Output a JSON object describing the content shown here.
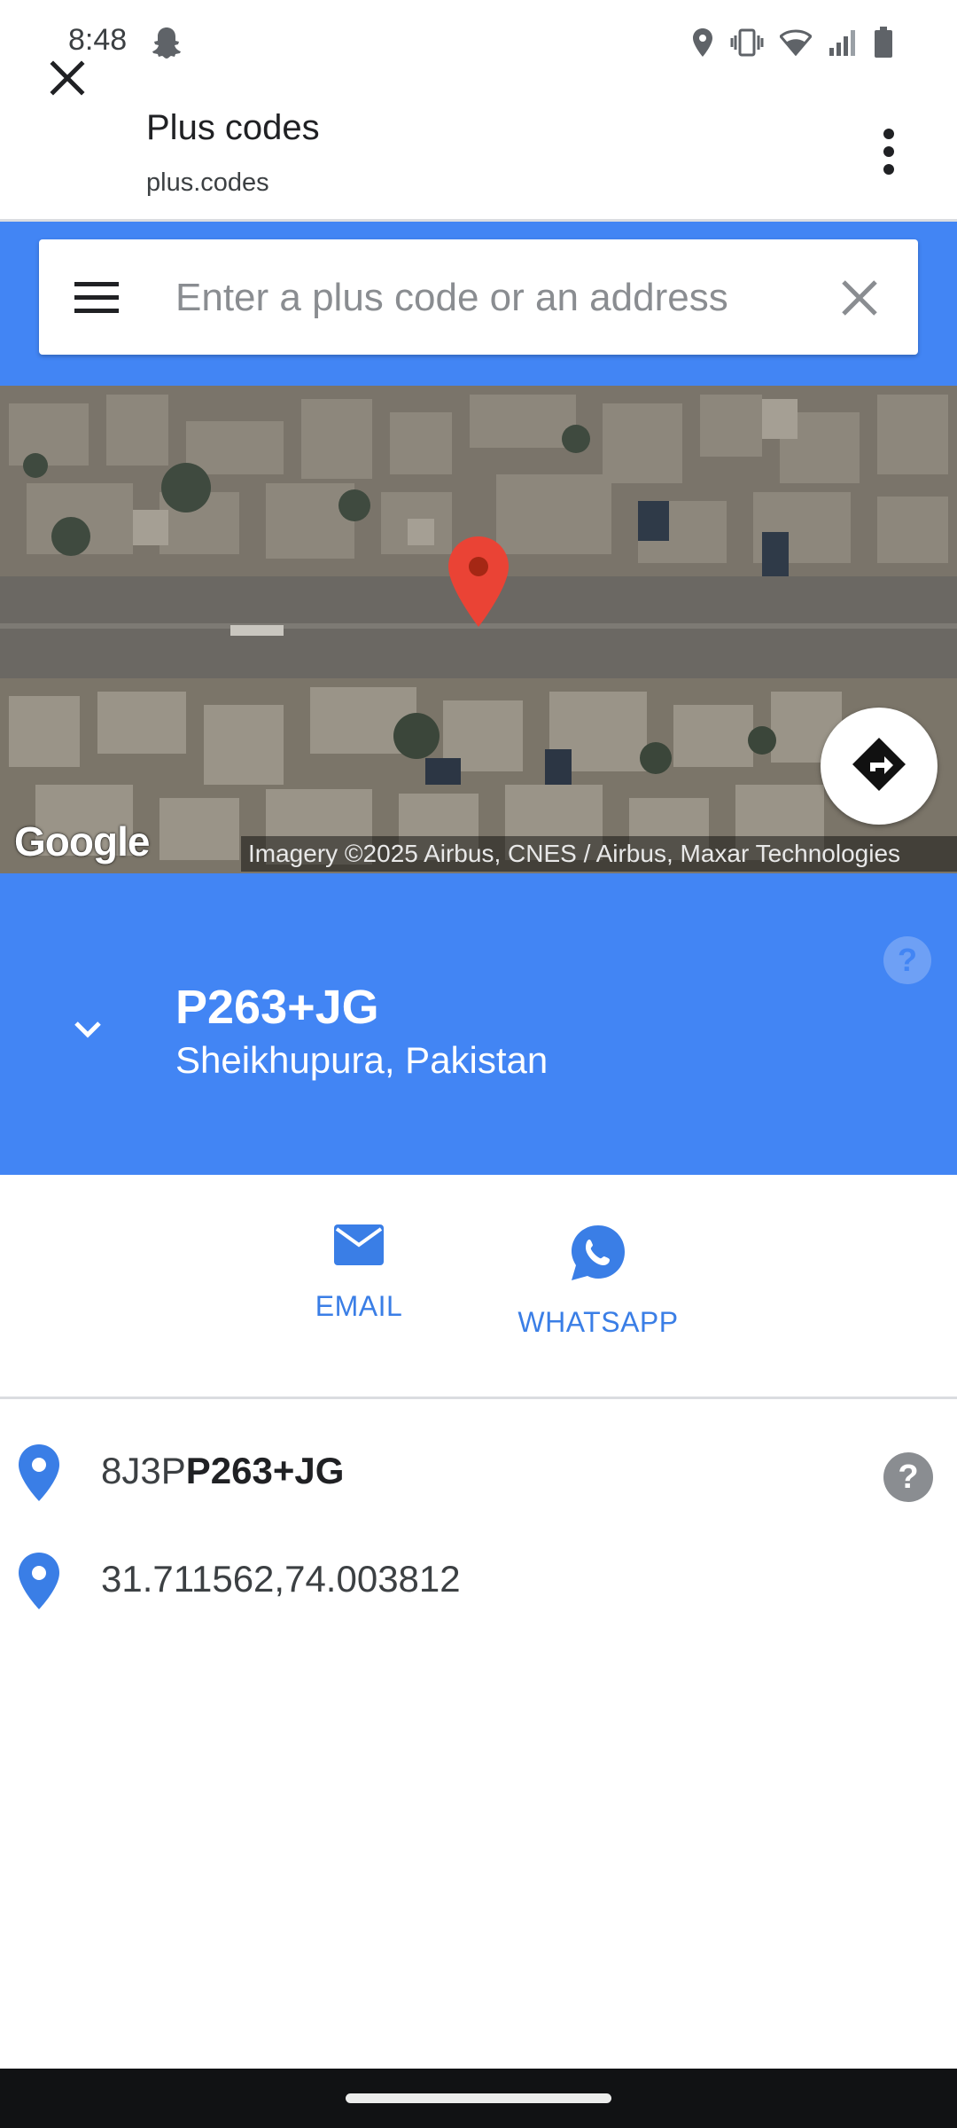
{
  "status_bar": {
    "time": "8:48",
    "icons": [
      "snapchat-ghost-icon",
      "location-icon",
      "vibrate-icon",
      "wifi-icon",
      "signal-icon",
      "battery-icon"
    ]
  },
  "toolbar": {
    "title": "Plus codes",
    "url": "plus.codes",
    "close_icon": "close-icon",
    "menu_icon": "more-vert-icon"
  },
  "search": {
    "placeholder": "Enter a plus code or an address",
    "value": "",
    "menu_icon": "hamburger-icon",
    "clear_icon": "clear-icon"
  },
  "map": {
    "logo": "Google",
    "attribution": "Imagery ©2025 Airbus, CNES / Airbus, Maxar Technologies",
    "marker_icon": "map-pin-icon",
    "directions_icon": "directions-icon"
  },
  "info": {
    "code": "P263+JG",
    "locality": "Sheikhupura, Pakistan",
    "help_icon": "help-icon",
    "collapse_icon": "chevron-down-icon"
  },
  "share": {
    "email_label": "EMAIL",
    "whatsapp_label": "WHATSAPP"
  },
  "details": {
    "full_code_prefix": "8J3P",
    "full_code_suffix": "P263+JG",
    "coordinates": "31.711562,74.003812"
  },
  "colors": {
    "brand_blue": "#4285f4",
    "link_blue": "#3a7ee6",
    "pin_red": "#ea4335"
  }
}
